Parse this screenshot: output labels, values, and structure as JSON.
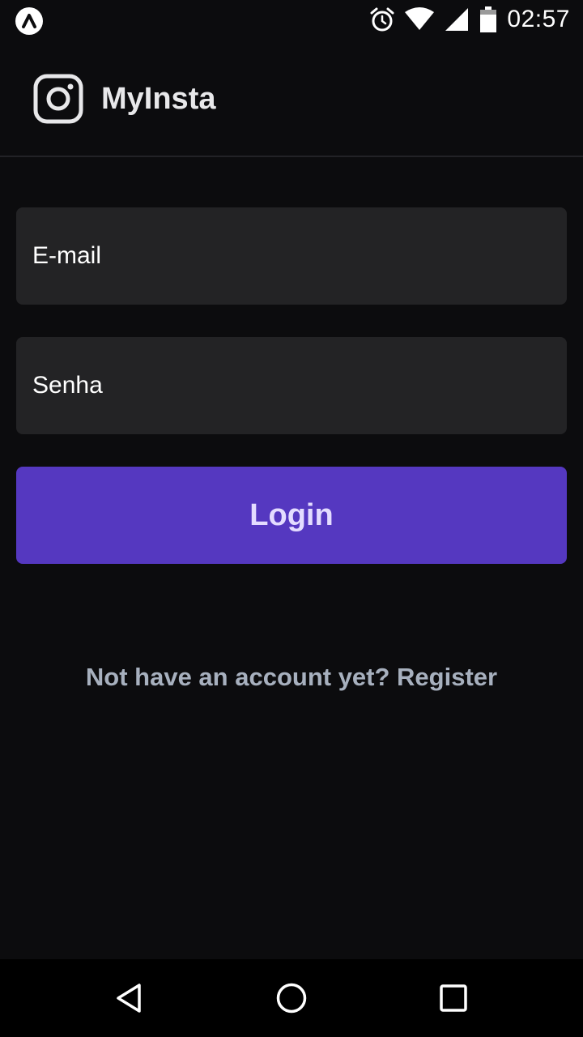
{
  "status_bar": {
    "time": "02:57",
    "icons": [
      "app-notification-icon",
      "alarm-icon",
      "wifi-icon",
      "cell-signal-icon",
      "battery-icon"
    ]
  },
  "header": {
    "title": "MyInsta",
    "logo_icon": "instagram-logo-icon"
  },
  "form": {
    "email_placeholder": "E-mail",
    "password_placeholder": "Senha",
    "login_label": "Login"
  },
  "footer": {
    "register_text": "Not have an account yet? Register"
  },
  "nav_bar": {
    "icons": [
      "back-icon",
      "home-icon",
      "recents-icon"
    ]
  },
  "colors": {
    "background": "#0c0c0e",
    "input_background": "#232325",
    "button_accent": "#5538c0",
    "link_text": "#a7b0be"
  }
}
